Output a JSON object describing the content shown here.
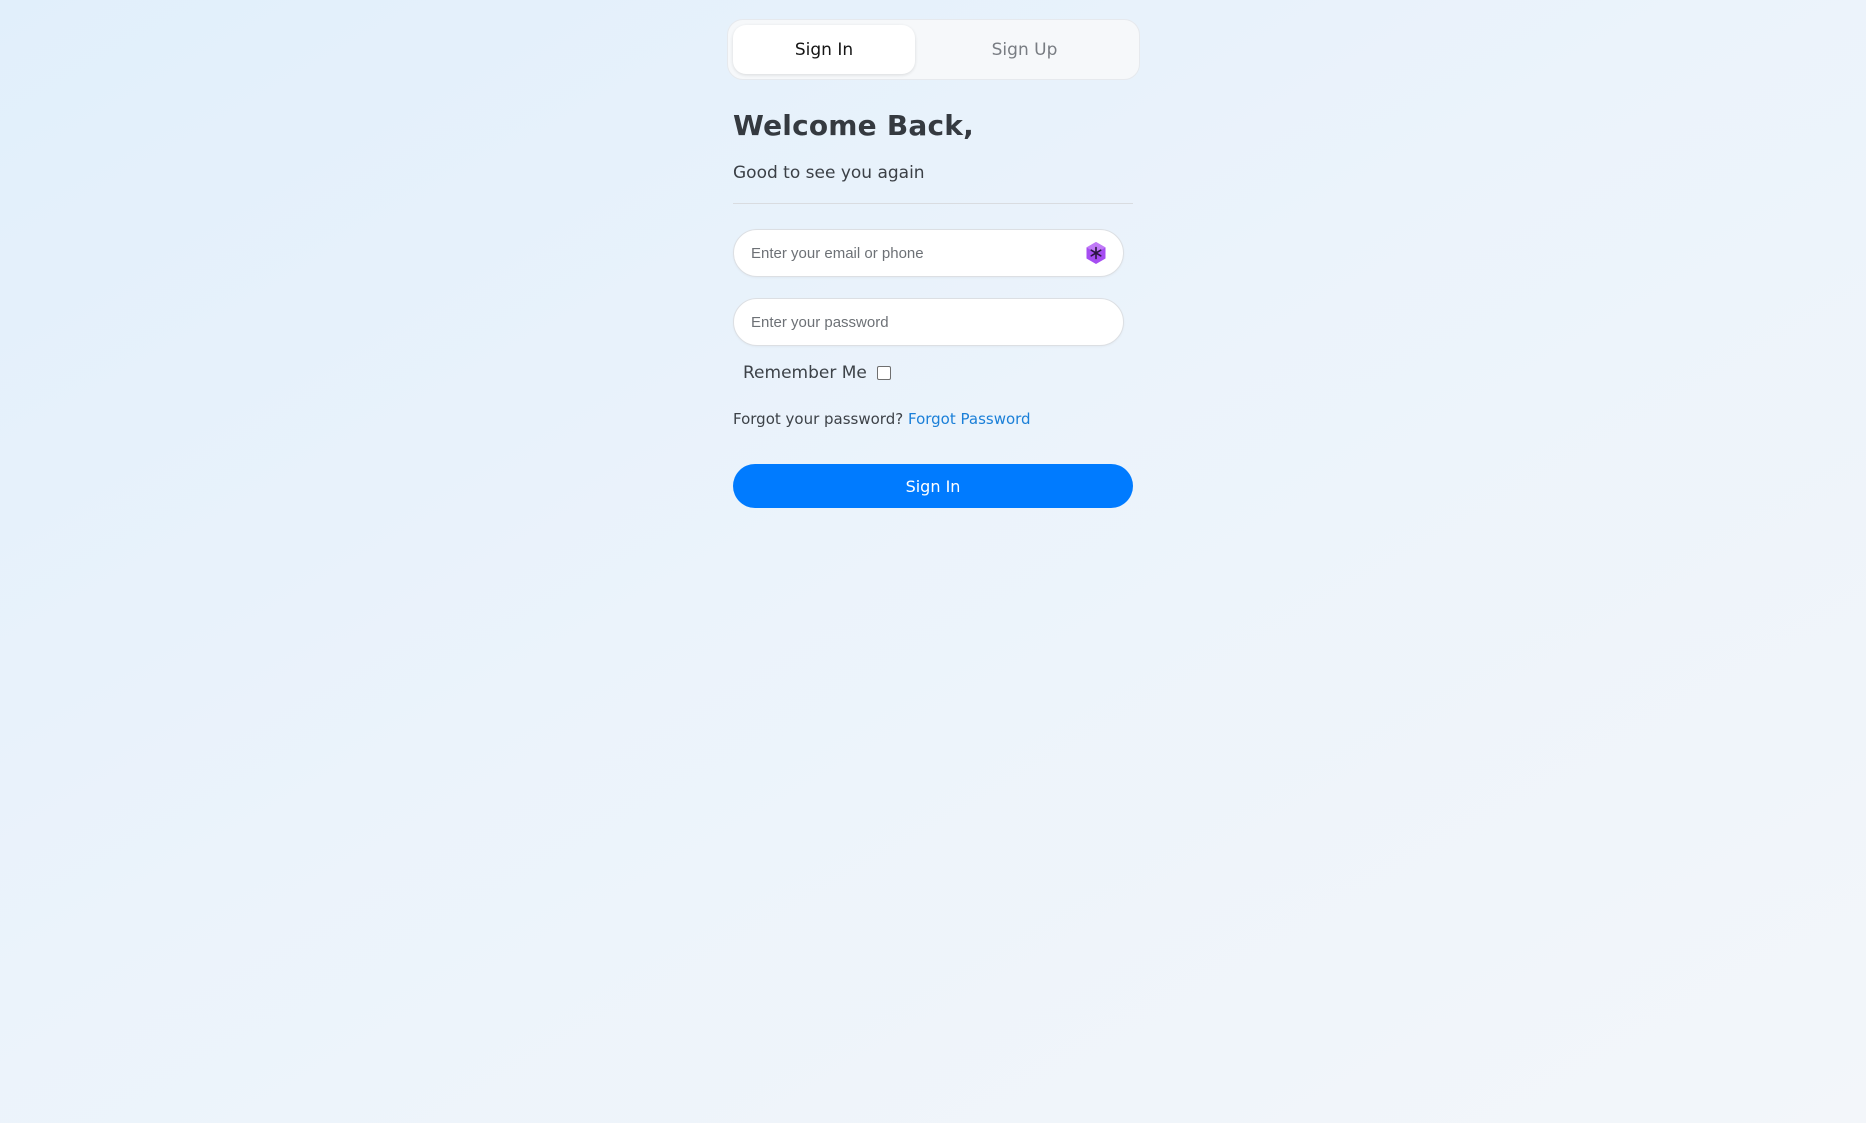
{
  "tabs": {
    "sign_in": "Sign In",
    "sign_up": "Sign Up"
  },
  "header": {
    "title": "Welcome Back,",
    "subtitle": "Good to see you again"
  },
  "form": {
    "email_placeholder": "Enter your email or phone",
    "email_value": "",
    "email_icon": "password-manager-hexagon-icon",
    "password_placeholder": "Enter your password",
    "password_value": "",
    "remember_label": "Remember Me",
    "remember_checked": false,
    "forgot_prompt": "Forgot your password?",
    "forgot_link": "Forgot Password",
    "submit_label": "Sign In"
  },
  "colors": {
    "accent": "#007bff",
    "link": "#1a7fd8",
    "icon": "#a64df2"
  }
}
